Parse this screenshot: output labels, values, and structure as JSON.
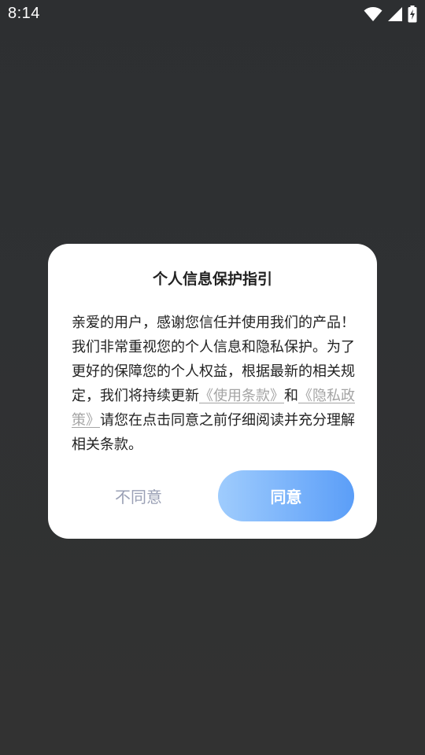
{
  "status_bar": {
    "time": "8:14",
    "icons": [
      "wifi-icon",
      "signal-icon",
      "battery-charging-icon"
    ]
  },
  "dialog": {
    "title": "个人信息保护指引",
    "body_text_1": "亲爱的用户，感谢您信任并使用我们的产品！我们非常重视您的个人信息和隐私保护。为了更好的保障您的个人权益，根据最新的相关规定，我们将持续更新",
    "terms_link": "《使用条款》",
    "body_text_2": "和",
    "privacy_link": "《隐私政策》",
    "body_text_3": "请您在点击同意之前仔细阅读并充分理解相关条款。",
    "disagree_label": "不同意",
    "agree_label": "同意"
  },
  "colors": {
    "background": "#2f3133",
    "link": "#a4a4a4",
    "disagree_text": "#9aa0b5",
    "agree_gradient_start": "#9fccfd",
    "agree_gradient_end": "#5b9ef8"
  }
}
